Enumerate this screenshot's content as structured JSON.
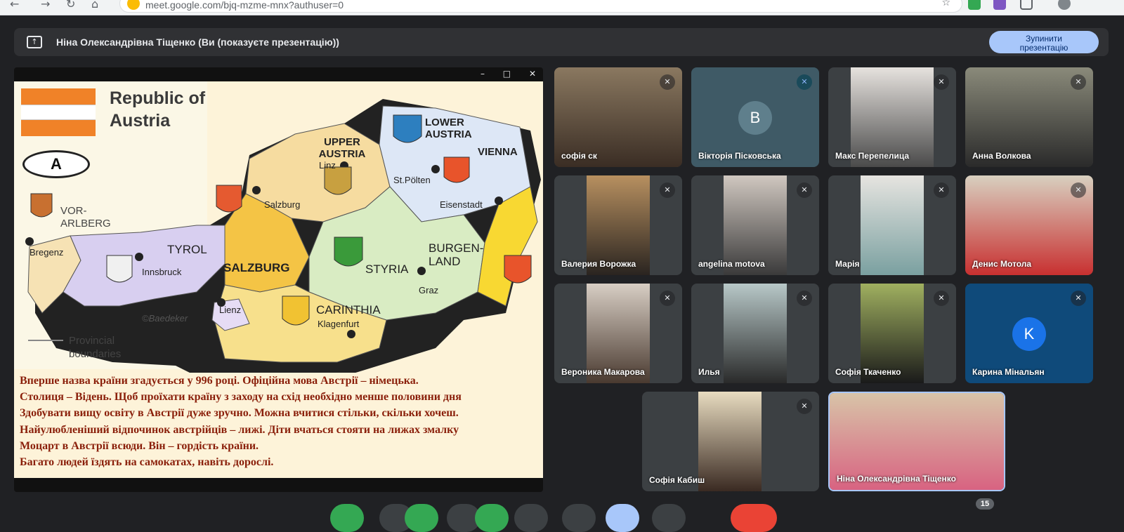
{
  "browser": {
    "url": "meet.google.com/bjq-mzme-mnx?authuser=0"
  },
  "presentation_bar": {
    "title": "Ніна Олександрівна Тіщенко (Ви (показуєте презентацію))",
    "stop_button_line1": "Зупинити",
    "stop_button_line2": "презентацію"
  },
  "slide": {
    "title_line1": "Republic of",
    "title_line2": "Austria",
    "oval_letter": "A",
    "legend_line1": "Provincial",
    "legend_line2": "boundaries",
    "copyright": "©Baedeker",
    "map_labels": {
      "upper_austria": "UPPER AUSTRIA",
      "lower_austria": "LOWER AUSTRIA",
      "vienna": "VIENNA",
      "linz": "Linz",
      "st_polten": "St.Pölten",
      "eisenstadt": "Eisenstadt",
      "salzburg_city": "Salzburg",
      "vorarlberg": "VOR-ARLBERG",
      "bregenz": "Bregenz",
      "tyrol": "TYROL",
      "innsbruck": "Innsbruck",
      "salzburg": "SALZBURG",
      "styria": "STYRIA",
      "burgenland": "BURGEN-LAND",
      "graz": "Graz",
      "lienz": "Lienz",
      "carinthia": "CARINTHIA",
      "klagenfurt": "Klagenfurt"
    },
    "text_lines": [
      "Вперше назва країни згадується у 996 році. Офіційна мова Австрії – німецька.",
      "Столиця – Відень. Щоб проїхати країну з заходу на схід необхідно менше половини дня",
      "Здобувати вищу освіту в Австрії дуже зручно. Можна вчитися стільки, скільки хочеш.",
      "Найулюбленіший відпочинок австрійців – лижі. Діти вчаться стояти на лижах змалку",
      "Моцарт в Австрії всюди. Він – гордість країни.",
      "Багато людей їздять на самокатах, навіть дорослі."
    ]
  },
  "participants": [
    {
      "name": "софія ск",
      "avatar": ""
    },
    {
      "name": "Вікторія Пісковська",
      "avatar": "B"
    },
    {
      "name": "Макс Перепелица",
      "avatar": ""
    },
    {
      "name": "Анна Волкова",
      "avatar": ""
    },
    {
      "name": "Валерия Ворожка",
      "avatar": ""
    },
    {
      "name": "angelina motova",
      "avatar": ""
    },
    {
      "name": "Марія",
      "avatar": ""
    },
    {
      "name": "Денис Мотола",
      "avatar": ""
    },
    {
      "name": "Вероника Макарова",
      "avatar": ""
    },
    {
      "name": "Илья",
      "avatar": ""
    },
    {
      "name": "Софія Ткаченко",
      "avatar": ""
    },
    {
      "name": "Карина Мінальян",
      "avatar": "K"
    },
    {
      "name": "Софія Кабиш",
      "avatar": ""
    },
    {
      "name": "Ніна Олександрівна Тіщенко",
      "avatar": ""
    }
  ],
  "people_count": "15",
  "colors": {
    "meet_bg": "#202124",
    "tile_bg": "#3c4043",
    "stop_button": "#a8c7fa",
    "avatar_v": "#5f7f8c",
    "avatar_k": "#1a73e8",
    "slide_text": "#8a1f0a"
  }
}
